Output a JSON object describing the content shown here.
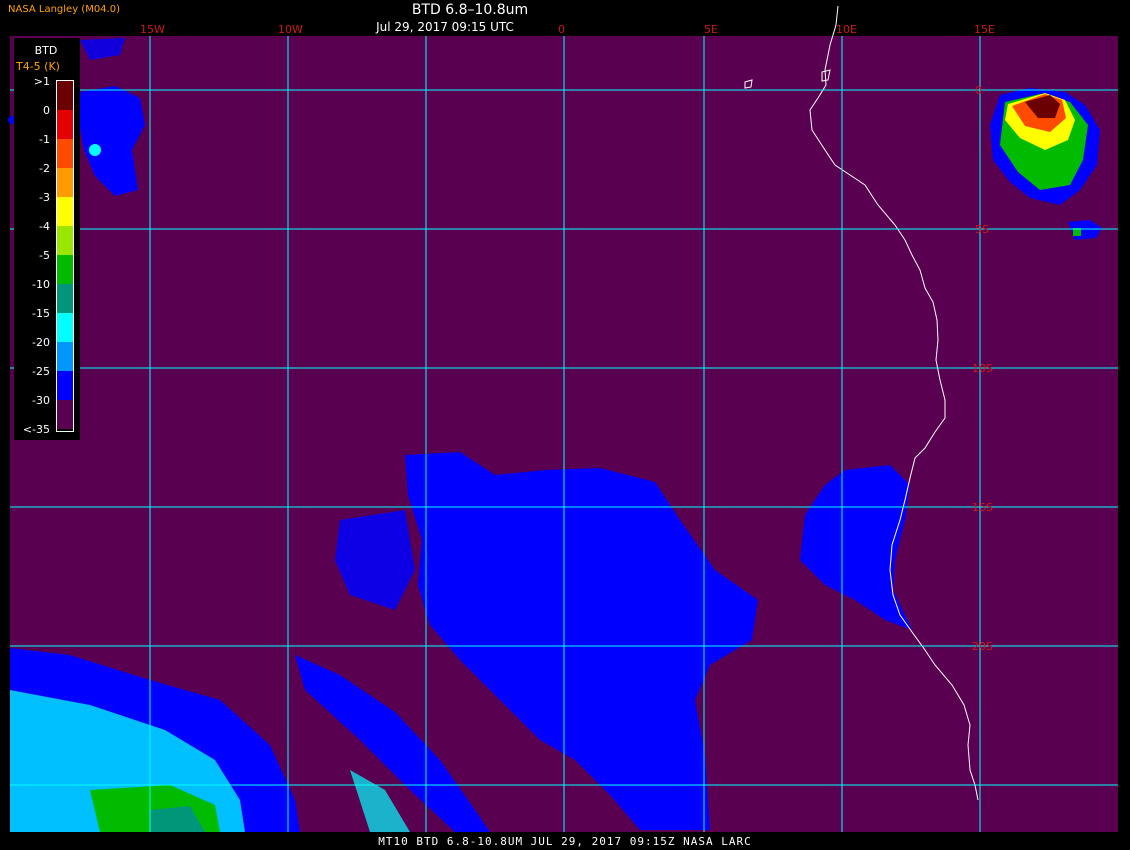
{
  "header": {
    "title": "BTD 6.8–10.8um",
    "datetime": "Jul 29, 2017 09:15 UTC",
    "org_label": "NASA Langley (M04.0)"
  },
  "footer": {
    "text": "MT10  BTD 6.8-10.8UM   JUL 29, 2017 09:15Z   NASA LARC"
  },
  "legend": {
    "title": "BTD",
    "subtitle": "T4-5 (K)",
    "labels": [
      ">1",
      "0",
      "-1",
      "-2",
      "-3",
      "-4",
      "-5",
      "-10",
      "-15",
      "-20",
      "-25",
      "-30",
      "<-35"
    ],
    "colors": [
      "#6b0000",
      "#e30000",
      "#ff4b00",
      "#ff9a00",
      "#ffff00",
      "#9ae600",
      "#00bb00",
      "#00967a",
      "#00ffff",
      "#0096ff",
      "#0000ff",
      "#5a0050"
    ]
  },
  "map": {
    "background_color": "#5a0050",
    "grid_color": "#00ffff",
    "coast_color": "#ffffff",
    "lon_labels": [
      "15W",
      "10W",
      "0",
      "5E",
      "10E",
      "15E"
    ],
    "lat_labels": [
      "0",
      "5S",
      "10S",
      "15S",
      "20S"
    ]
  }
}
